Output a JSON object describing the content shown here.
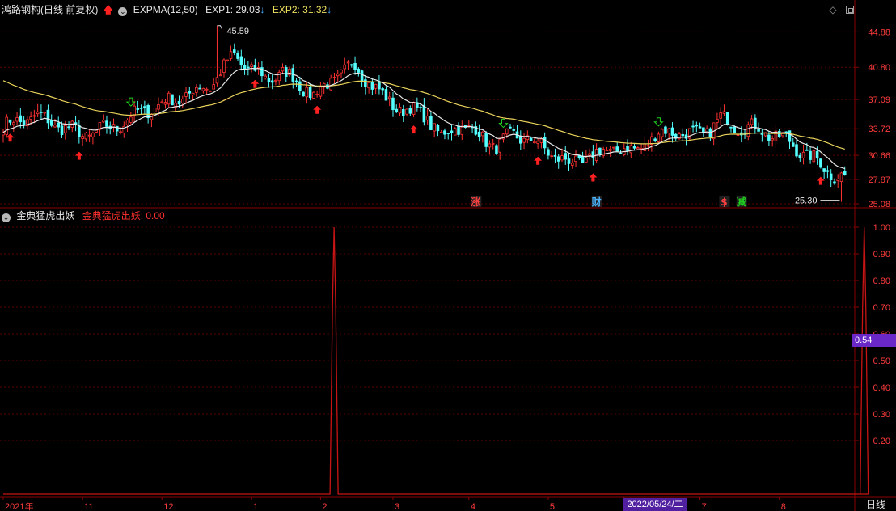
{
  "header": {
    "stock_title": "鸿路钢构(日线 前复权)",
    "indicator_name": "EXPMA(12,50)",
    "exp1_text": "EXP1: 29.03",
    "exp2_text": "EXP2: 31.32",
    "down_arrow": "↓",
    "up_arrow": "🡅"
  },
  "sub_header": {
    "indicator_name": "金典猛虎出妖",
    "signal_text": "金典猛虎出妖: 0.00"
  },
  "top_right": {
    "diamond": "◇"
  },
  "colors": {
    "up": "#ff3232",
    "down": "#54ffff",
    "exp1": "#e8e8e8",
    "exp2": "#e8d25a",
    "signal_line": "#c81414",
    "axis_text": "#ff3c3c",
    "grid": "#5a0000",
    "border": "#8c0000",
    "buy_arrow": "#ff2020",
    "sell_arrow": "#20d020",
    "zhang_label": "#ff4040",
    "cai_label": "#4ab4ff",
    "dollar_label": "#ff4040",
    "jian_label": "#20d020"
  },
  "price_axis": {
    "labels": [
      "44.88",
      "40.80",
      "37.09",
      "33.72",
      "30.66",
      "27.87",
      "25.08"
    ]
  },
  "signal_axis": {
    "labels": [
      "1.00",
      "0.90",
      "0.80",
      "0.70",
      "0.60",
      "0.50",
      "0.40",
      "0.30",
      "0.20"
    ]
  },
  "time_axis": {
    "labels": [
      "2021年",
      "11",
      "12",
      "1",
      "2",
      "3",
      "4",
      "5",
      "6",
      "7",
      "8"
    ]
  },
  "annotations": {
    "high": "45.59",
    "low": "25.30",
    "zhang": "涨",
    "cai": "财",
    "dollar": "$",
    "jian": "减"
  },
  "cursor": {
    "value_label": "0.54",
    "date_label": "2022/05/24/二"
  },
  "period_label": "日线",
  "chart_data": [
    {
      "type": "candlestick",
      "title": "鸿路钢构(日线 前复权)",
      "ylim": [
        25.08,
        46.5
      ],
      "axis_labels": [
        "44.88",
        "40.80",
        "37.09",
        "33.72",
        "30.66",
        "27.87",
        "25.08"
      ],
      "period_labels": [
        "2021年",
        "11",
        "12",
        "1",
        "2",
        "3",
        "4",
        "5",
        "6",
        "7",
        "8"
      ],
      "period_boundaries": [
        0,
        20,
        40,
        62,
        80,
        98,
        117,
        137,
        156,
        175,
        195,
        212
      ],
      "close_keypoints": [
        [
          0,
          34.0
        ],
        [
          8,
          35.2
        ],
        [
          20,
          33.0
        ],
        [
          28,
          34.0
        ],
        [
          36,
          36.0
        ],
        [
          44,
          37.2
        ],
        [
          52,
          38.8
        ],
        [
          58,
          42.2
        ],
        [
          62,
          40.5
        ],
        [
          66,
          39.5
        ],
        [
          70,
          40.2
        ],
        [
          74,
          39.0
        ],
        [
          78,
          37.6
        ],
        [
          80,
          38.2
        ],
        [
          84,
          40.0
        ],
        [
          88,
          41.0
        ],
        [
          92,
          39.2
        ],
        [
          96,
          37.0
        ],
        [
          100,
          36.0
        ],
        [
          106,
          35.4
        ],
        [
          110,
          32.6
        ],
        [
          114,
          34.2
        ],
        [
          118,
          33.4
        ],
        [
          124,
          31.6
        ],
        [
          128,
          33.2
        ],
        [
          132,
          32.5
        ],
        [
          138,
          30.8
        ],
        [
          142,
          29.6
        ],
        [
          148,
          30.6
        ],
        [
          154,
          31.6
        ],
        [
          158,
          31.0
        ],
        [
          162,
          32.5
        ],
        [
          168,
          33.6
        ],
        [
          172,
          32.9
        ],
        [
          176,
          33.4
        ],
        [
          180,
          34.8
        ],
        [
          184,
          34.1
        ],
        [
          190,
          33.6
        ],
        [
          196,
          32.5
        ],
        [
          202,
          30.6
        ],
        [
          206,
          29.2
        ],
        [
          210,
          28.2
        ]
      ],
      "ema12_last": 29.03,
      "ema50_last": 31.32,
      "annotated_high": 45.59,
      "annotated_low": 25.3,
      "buy_signals": [
        2,
        22,
        73,
        91,
        119,
        155,
        171,
        237
      ],
      "sell_signals": [
        37,
        145,
        190
      ],
      "text_markers": [
        {
          "label": "涨",
          "index": 137
        },
        {
          "label": "财",
          "index": 172
        },
        {
          "label": "$",
          "index": 209
        },
        {
          "label": "减",
          "index": 214
        }
      ]
    },
    {
      "type": "line",
      "title": "金典猛虎出妖",
      "ylim": [
        0,
        1.0
      ],
      "axis_labels": [
        "1.00",
        "0.90",
        "0.80",
        "0.70",
        "0.60",
        "0.50",
        "0.40",
        "0.30",
        "0.20"
      ],
      "spikes": [
        {
          "index": 83,
          "value": 1.0
        },
        {
          "index": 216,
          "value": 1.0
        }
      ],
      "baseline": 0.0,
      "last_value": 0.0,
      "cursor_value": 0.54,
      "cursor_date": "2022/05/24/二"
    }
  ]
}
